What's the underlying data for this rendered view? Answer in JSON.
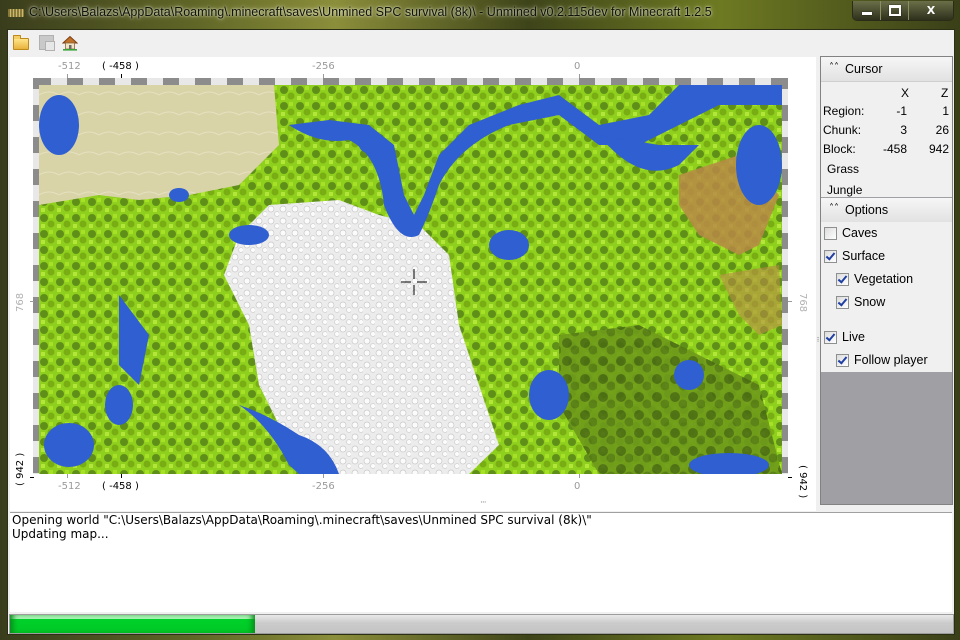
{
  "window": {
    "title": "C:\\Users\\Balazs\\AppData\\Roaming\\.minecraft\\saves\\Unmined SPC survival (8k)\\ - Unmined v0.2.115dev for Minecraft 1.2.5",
    "close_label": "X"
  },
  "toolbar": {
    "icons": [
      "folder-open-icon",
      "save-map-icon",
      "home-icon"
    ]
  },
  "ruler": {
    "x_labels": [
      "-512",
      "-256",
      "0"
    ],
    "x_cursor": "( -458 )",
    "z_labels": [
      "768"
    ],
    "z_cursor": "( 942 )"
  },
  "cursor_panel": {
    "title": "Cursor",
    "col_x": "X",
    "col_z": "Z",
    "rows": [
      {
        "label": "Region:",
        "x": "-1",
        "z": "1"
      },
      {
        "label": "Chunk:",
        "x": "3",
        "z": "26"
      },
      {
        "label": "Block:",
        "x": "-458",
        "z": "942"
      }
    ],
    "block_type": "Grass",
    "biome": "Jungle"
  },
  "options_panel": {
    "title": "Options",
    "items": [
      {
        "label": "Caves",
        "checked": false
      },
      {
        "label": "Surface",
        "checked": true
      },
      {
        "label": "Vegetation",
        "checked": true
      },
      {
        "label": "Snow",
        "checked": true
      },
      {
        "label": "Live",
        "checked": true
      },
      {
        "label": "Follow player",
        "checked": true
      }
    ]
  },
  "log": {
    "lines": [
      "Opening world \"C:\\Users\\Balazs\\AppData\\Roaming\\.minecraft\\saves\\Unmined SPC survival (8k)\\\"",
      "Updating map..."
    ]
  },
  "progress": {
    "percent": 26
  },
  "colors": {
    "progress_green": "#00d12a",
    "water": "#2f5fd0",
    "grass": "#8fcf1e",
    "snow": "#efefef",
    "desert": "#d9d3a8",
    "mountain": "#a8743a"
  }
}
